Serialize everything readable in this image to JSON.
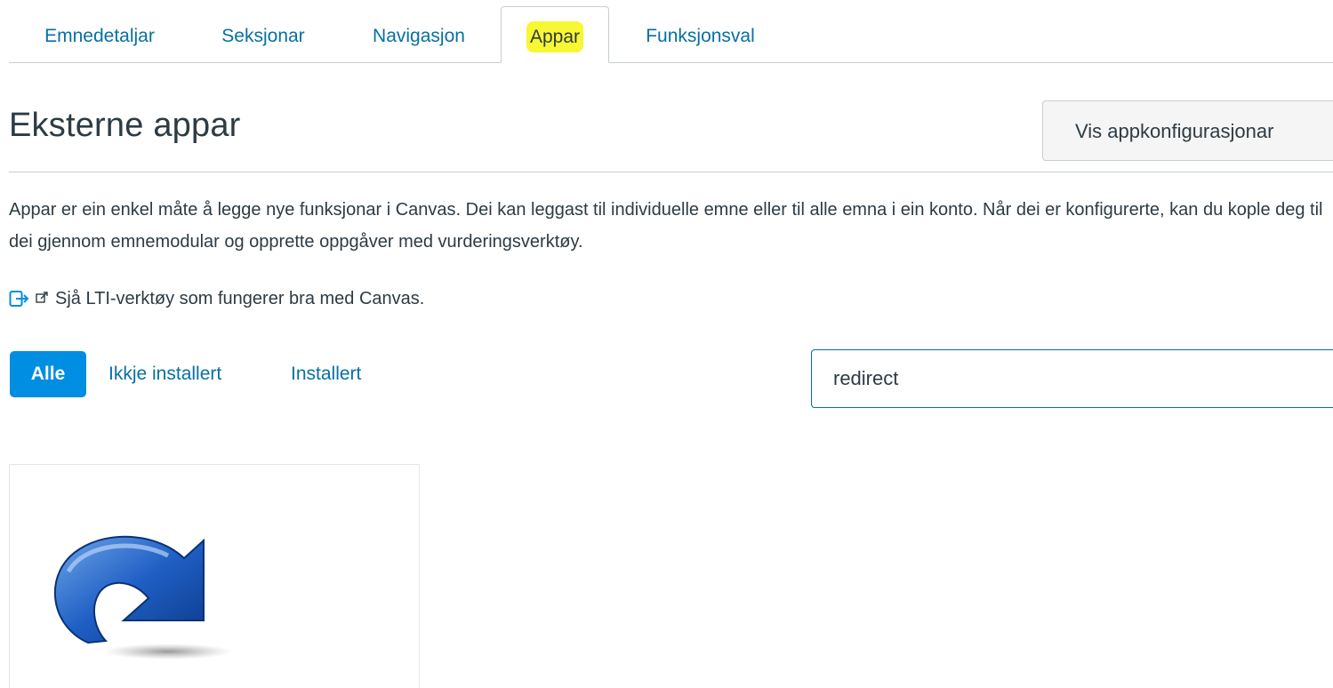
{
  "tabs": [
    {
      "label": "Emnedetaljar",
      "active": false
    },
    {
      "label": "Seksjonar",
      "active": false
    },
    {
      "label": "Navigasjon",
      "active": false
    },
    {
      "label": "Appar",
      "active": true
    },
    {
      "label": "Funksjonsval",
      "active": false
    }
  ],
  "header": {
    "title": "Eksterne appar",
    "config_button": "Vis appkonfigurasjonar"
  },
  "description": "Appar er ein enkel måte å legge nye funksjonar i Canvas. Dei kan leggast til individuelle emne eller til alle emna i ein konto. Når dei er konfigurerte, kan du kople deg til dei gjennom emnemodular og opprette oppgåver med vurderingsverktøy.",
  "lti_link": {
    "text": "Sjå LTI-verktøy som fungerer bra med Canvas.",
    "icon": "external-link-icon"
  },
  "filters": {
    "all": "Alle",
    "not_installed": "Ikkje installert",
    "installed": "Installert",
    "selected": "Alle"
  },
  "search": {
    "value": "redirect"
  },
  "apps": [
    {
      "icon": "redirect-arrow-icon"
    }
  ],
  "colors": {
    "link": "#0770a3",
    "primary": "#008ee2",
    "text": "#2d3b45",
    "border": "#c7cdd1",
    "highlight": "#f7f733"
  }
}
